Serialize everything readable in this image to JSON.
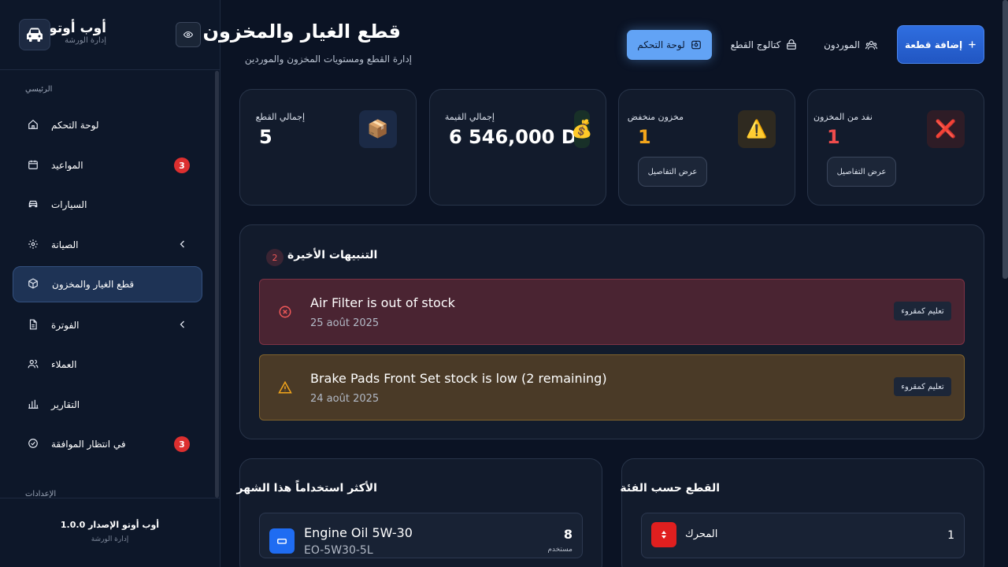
{
  "brand": {
    "name": "أوب أوتو",
    "subtitle": "إدارة الورشة"
  },
  "sidebar": {
    "section_main": "الرئيسي",
    "section_settings": "الإعدادات",
    "items": [
      {
        "label": "لوحة التحكم",
        "icon": "home-icon"
      },
      {
        "label": "المواعيد",
        "icon": "calendar-icon",
        "badge": "3"
      },
      {
        "label": "السيارات",
        "icon": "car-icon"
      },
      {
        "label": "الصيانة",
        "icon": "gear-icon",
        "chevron": true
      },
      {
        "label": "قطع الغيار والمخزون",
        "icon": "box-icon",
        "active": true
      },
      {
        "label": "الفوترة",
        "icon": "document-icon",
        "chevron": true
      },
      {
        "label": "العملاء",
        "icon": "users-icon"
      },
      {
        "label": "التقارير",
        "icon": "bar-chart-icon"
      },
      {
        "label": "في انتظار الموافقة",
        "icon": "check-circle-icon",
        "badge": "3"
      }
    ],
    "footer": {
      "version": "أوب أوتو الإصدار 1.0.0",
      "subtitle": "إدارة الورشة"
    }
  },
  "header": {
    "title": "قطع الغيار والمخزون",
    "subtitle": "إدارة القطع ومستويات المخزون والموردين",
    "add_button": "إضافة قطعة",
    "suppliers": "الموردون",
    "catalog": "كتالوج القطع",
    "dashboard": "لوحة التحكم"
  },
  "stats": {
    "total_parts": {
      "label": "إجمالي القطع",
      "value": "5",
      "icon": "📦"
    },
    "total_value": {
      "label": "إجمالي القيمة",
      "value": "6 546,000 DT",
      "icon": "💰"
    },
    "low_stock": {
      "label": "مخزون منخفض",
      "value": "1",
      "icon": "⚠️",
      "details": "عرض التفاصيل"
    },
    "out_of_stock": {
      "label": "نفد من المخزون",
      "value": "1",
      "icon": "❌",
      "details": "عرض التفاصيل"
    }
  },
  "alerts": {
    "title": "التنبيهات الأخيرة",
    "count": "2",
    "mark_read": "تعليم كمقروء",
    "items": [
      {
        "type": "danger",
        "message": "Air Filter is out of stock",
        "date": "25 août 2025"
      },
      {
        "type": "warning",
        "message": "Brake Pads Front Set stock is low (2 remaining)",
        "date": "24 août 2025"
      }
    ]
  },
  "most_used": {
    "title": "الأكثر استخداماً هذا الشهر",
    "rows": [
      {
        "name": "Engine Oil 5W-30",
        "code": "EO-5W30-5L",
        "count": "8",
        "count_label": "مستخدم"
      }
    ]
  },
  "by_category": {
    "title": "القطع حسب الفئة",
    "rows": [
      {
        "name": "المحرك",
        "count": "1"
      }
    ]
  },
  "colors": {
    "accent": "#2f6ee0",
    "danger": "#ef4444",
    "warning": "#f59e0b",
    "background": "#0b1324"
  }
}
